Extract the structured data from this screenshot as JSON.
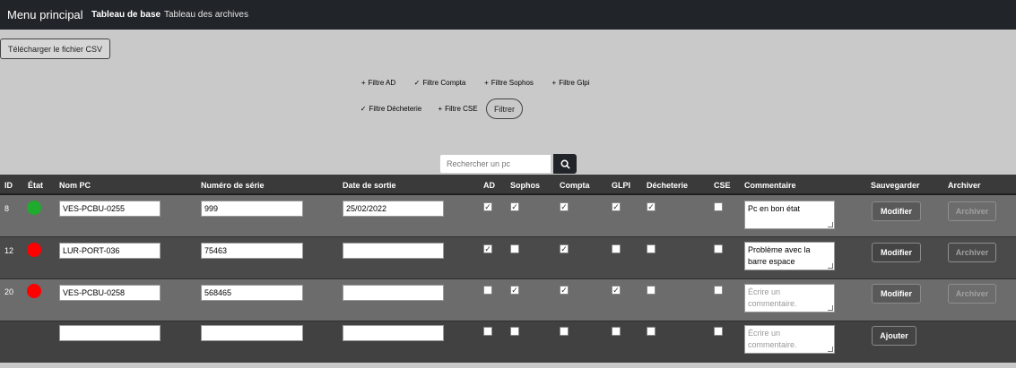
{
  "topbar": {
    "brand": "Menu principal",
    "nav_active": "Tableau de base",
    "nav_other": "Tableau des archives"
  },
  "csv_button": "Télécharger le fichier CSV",
  "filters": [
    {
      "label": "Filtre AD",
      "active": false,
      "icon": "plus"
    },
    {
      "label": "Filtre Compta",
      "active": true,
      "icon": "check"
    },
    {
      "label": "Filtre Sophos",
      "active": false,
      "icon": "plus"
    },
    {
      "label": "Filtre Glpi",
      "active": false,
      "icon": "plus"
    },
    {
      "label": "Filtre Décheterie",
      "active": true,
      "icon": "check"
    },
    {
      "label": "Filtre CSE",
      "active": false,
      "icon": "plus"
    }
  ],
  "filter_button": "Filtrer",
  "search": {
    "placeholder": "Rechercher un pc",
    "icon": "search-icon"
  },
  "columns": [
    "ID",
    "État",
    "Nom PC",
    "Numéro de série",
    "Date de sortie",
    "AD",
    "Sophos",
    "Compta",
    "GLPI",
    "Décheterie",
    "CSE",
    "Commentaire",
    "Sauvegarder",
    "Archiver"
  ],
  "rows": [
    {
      "id": "8",
      "status": "green",
      "name": "VES-PCBU-0255",
      "serial": "999",
      "date": "25/02/2022",
      "ad": true,
      "sophos": true,
      "compta": true,
      "glpi": true,
      "decheterie": true,
      "cse": false,
      "comment": "Pc en bon état",
      "save": "Modifier",
      "archive": "Archiver"
    },
    {
      "id": "12",
      "status": "red",
      "name": "LUR-PORT-036",
      "serial": "75463",
      "date": "",
      "ad": true,
      "sophos": false,
      "compta": true,
      "glpi": false,
      "decheterie": false,
      "cse": false,
      "comment": "Problème avec la barre espace",
      "save": "Modifier",
      "archive": "Archiver"
    },
    {
      "id": "20",
      "status": "red",
      "name": "VES-PCBU-0258",
      "serial": "568465",
      "date": "",
      "ad": false,
      "sophos": true,
      "compta": true,
      "glpi": true,
      "decheterie": false,
      "cse": false,
      "comment": "",
      "comment_placeholder": "Écrire un commentaire.",
      "save": "Modifier",
      "archive": "Archiver"
    }
  ],
  "new_row": {
    "comment_placeholder": "Écrire un commentaire.",
    "add": "Ajouter"
  },
  "colors": {
    "topbar": "#212529",
    "page": "#c9c9c9",
    "accent": "#1ab6cf",
    "ok": "#1fab2e",
    "ko": "#ff0000"
  }
}
